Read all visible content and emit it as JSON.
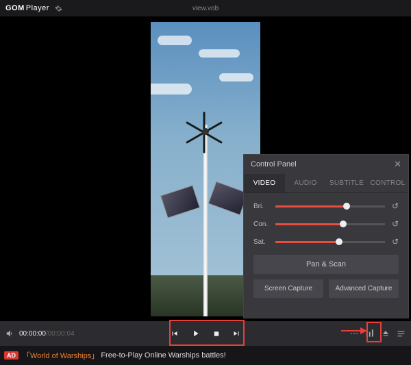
{
  "titlebar": {
    "logo_gom": "GOM",
    "logo_player": "Player",
    "filename": "view.vob"
  },
  "playback": {
    "current": "00:00:00",
    "duration": "00:00:04"
  },
  "controls": {
    "prev_icon": "prev",
    "play_icon": "play",
    "stop_icon": "stop",
    "next_icon": "next",
    "more_icon": "…",
    "panel_icon": "eq",
    "eject_icon": "eject",
    "list_icon": "list"
  },
  "control_panel": {
    "title": "Control Panel",
    "tabs": [
      "VIDEO",
      "AUDIO",
      "SUBTITLE",
      "CONTROL"
    ],
    "active_tab": 0,
    "sliders": [
      {
        "label": "Bri.",
        "value": 65
      },
      {
        "label": "Con.",
        "value": 62
      },
      {
        "label": "Sat.",
        "value": 58
      }
    ],
    "pan_scan": "Pan & Scan",
    "screen_capture": "Screen Capture",
    "advanced_capture": "Advanced Capture"
  },
  "ad": {
    "badge": "AD",
    "game": "「World of Warships」",
    "text": "Free-to-Play Online Warships battles!"
  }
}
